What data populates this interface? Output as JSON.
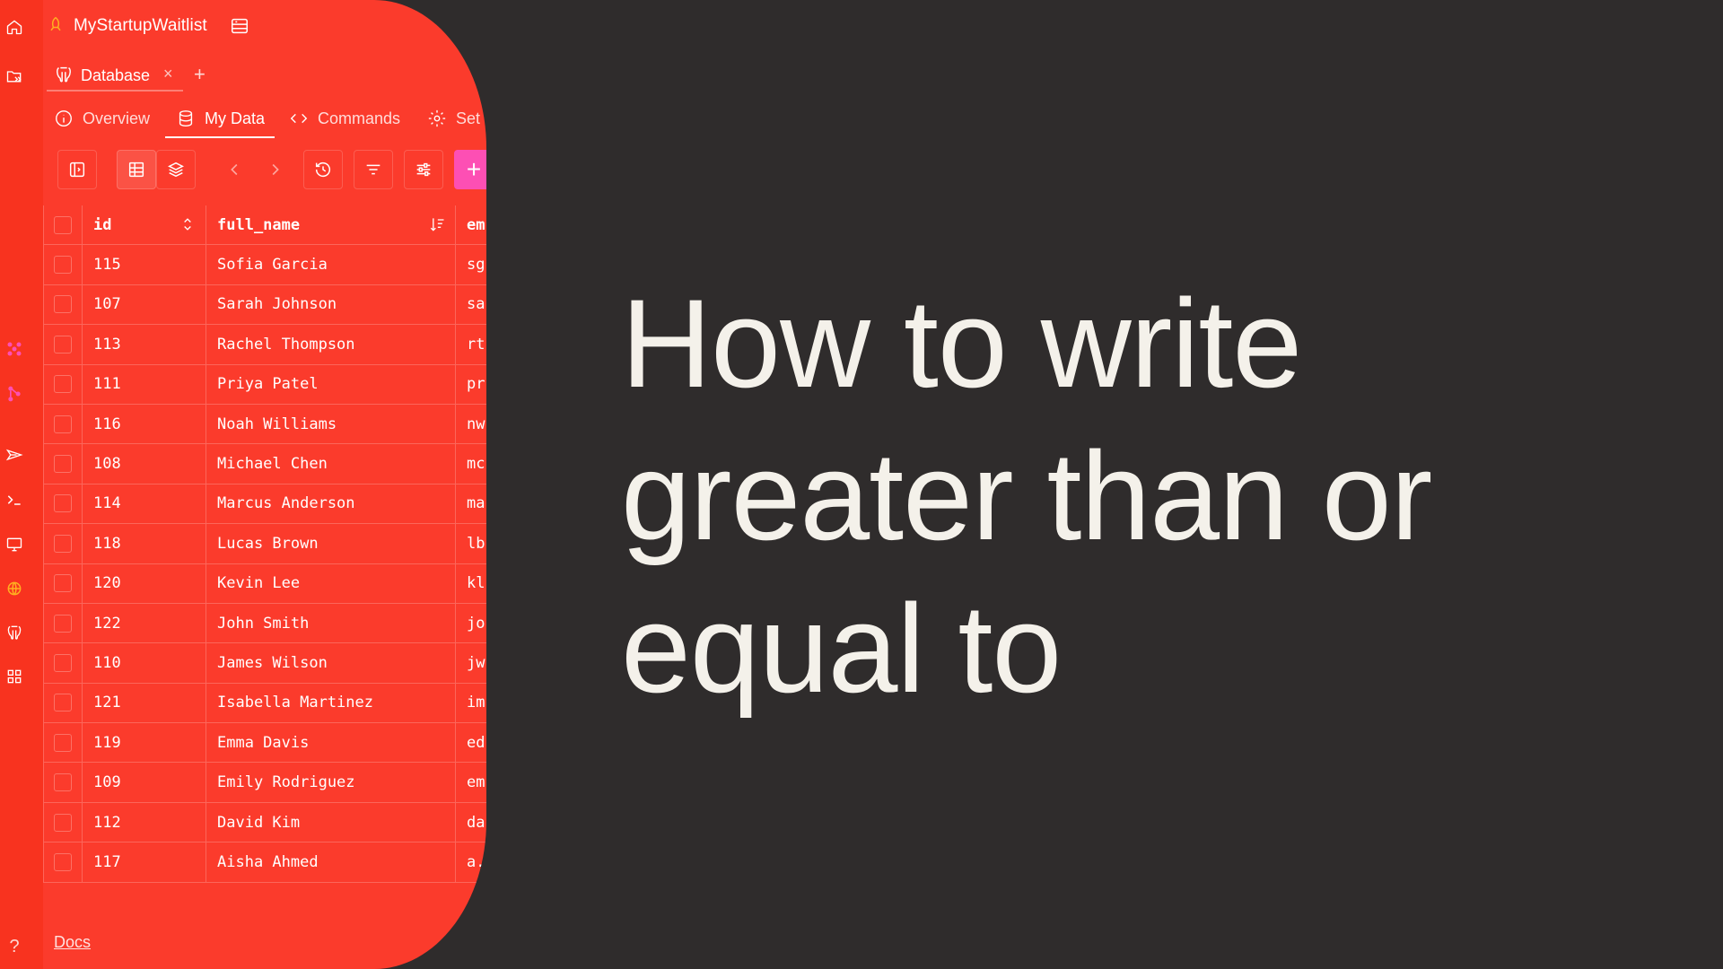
{
  "app": {
    "title": "MyStartupWaitlist"
  },
  "tab": {
    "label": "Database",
    "close": "×",
    "add": "+"
  },
  "subnav": {
    "overview": "Overview",
    "my_data": "My Data",
    "commands": "Commands",
    "settings": "Set"
  },
  "toolbar": {
    "add_label": "+"
  },
  "table": {
    "columns": [
      "id",
      "full_name",
      "em"
    ],
    "rows": [
      {
        "id": "115",
        "full_name": "Sofia Garcia",
        "email": "sg"
      },
      {
        "id": "107",
        "full_name": "Sarah Johnson",
        "email": "sa"
      },
      {
        "id": "113",
        "full_name": "Rachel Thompson",
        "email": "rt"
      },
      {
        "id": "111",
        "full_name": "Priya Patel",
        "email": "pr"
      },
      {
        "id": "116",
        "full_name": "Noah Williams",
        "email": "nw"
      },
      {
        "id": "108",
        "full_name": "Michael Chen",
        "email": "mc"
      },
      {
        "id": "114",
        "full_name": "Marcus Anderson",
        "email": "ma"
      },
      {
        "id": "118",
        "full_name": "Lucas Brown",
        "email": "lb"
      },
      {
        "id": "120",
        "full_name": "Kevin Lee",
        "email": "kl"
      },
      {
        "id": "122",
        "full_name": "John Smith",
        "email": "jo"
      },
      {
        "id": "110",
        "full_name": "James Wilson",
        "email": "jw"
      },
      {
        "id": "121",
        "full_name": "Isabella Martinez",
        "email": "im"
      },
      {
        "id": "119",
        "full_name": "Emma Davis",
        "email": "ed"
      },
      {
        "id": "109",
        "full_name": "Emily Rodriguez",
        "email": "em"
      },
      {
        "id": "112",
        "full_name": "David Kim",
        "email": "da"
      },
      {
        "id": "117",
        "full_name": "Aisha Ahmed",
        "email": "a."
      }
    ]
  },
  "footer": {
    "docs": "Docs",
    "help": "?"
  },
  "headline": {
    "line1": "How to write",
    "line2": "greater than or",
    "line3": "equal to"
  },
  "colors": {
    "panel": "#fb3b2c",
    "background": "#2f2c2c",
    "accent_pink": "#fd4fb4",
    "headline_text": "#f4f1ea"
  },
  "icons": {
    "rail": [
      "home-icon",
      "folder-open-icon",
      "apps-grid-icon",
      "git-branch-icon",
      "send-icon",
      "terminal-icon",
      "monitor-icon",
      "globe-icon",
      "postgres-icon",
      "grid-icon",
      "help-icon"
    ]
  }
}
